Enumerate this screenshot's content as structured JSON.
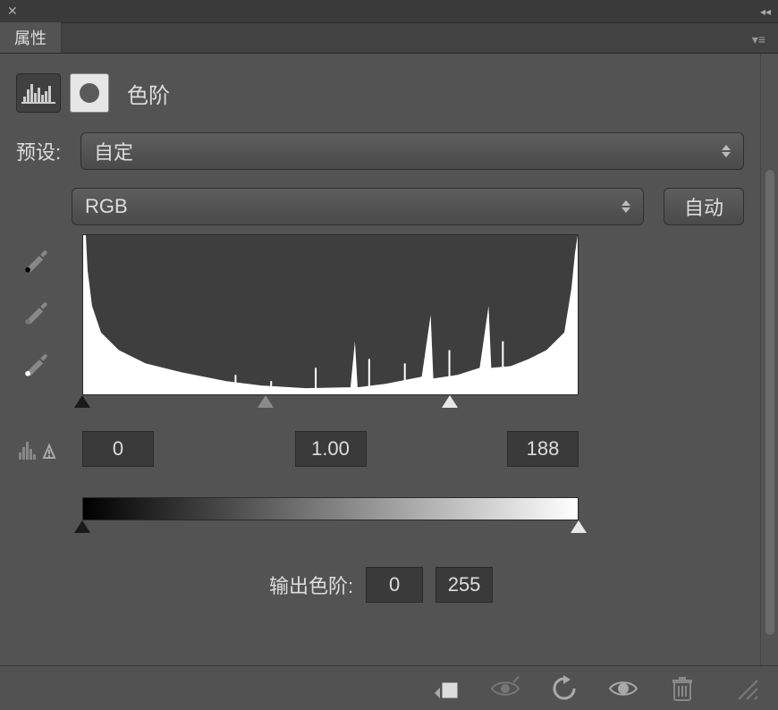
{
  "panel": {
    "tab_label": "属性",
    "title": "色阶"
  },
  "preset": {
    "label": "预设:",
    "value": "自定"
  },
  "channel": {
    "value": "RGB",
    "auto_label": "自动"
  },
  "input_levels": {
    "black": "0",
    "gamma": "1.00",
    "white": "188",
    "slider_black_pct": 0,
    "slider_gray_pct": 37,
    "slider_white_pct": 74
  },
  "output_levels": {
    "label": "输出色阶:",
    "black": "0",
    "white": "255",
    "slider_black_pct": 0,
    "slider_white_pct": 100
  },
  "icons": {
    "levels": "levels-histogram-icon",
    "mask": "layer-mask-icon",
    "eyedropper_black": "black-point-eyedropper",
    "eyedropper_gray": "gray-point-eyedropper",
    "eyedropper_white": "white-point-eyedropper",
    "clip_warning": "clip-warning-icon",
    "clip_to_layer": "clip-to-layer-icon",
    "prev_state": "view-previous-state-icon",
    "reset": "reset-icon",
    "visibility": "visibility-icon",
    "delete": "delete-icon"
  }
}
